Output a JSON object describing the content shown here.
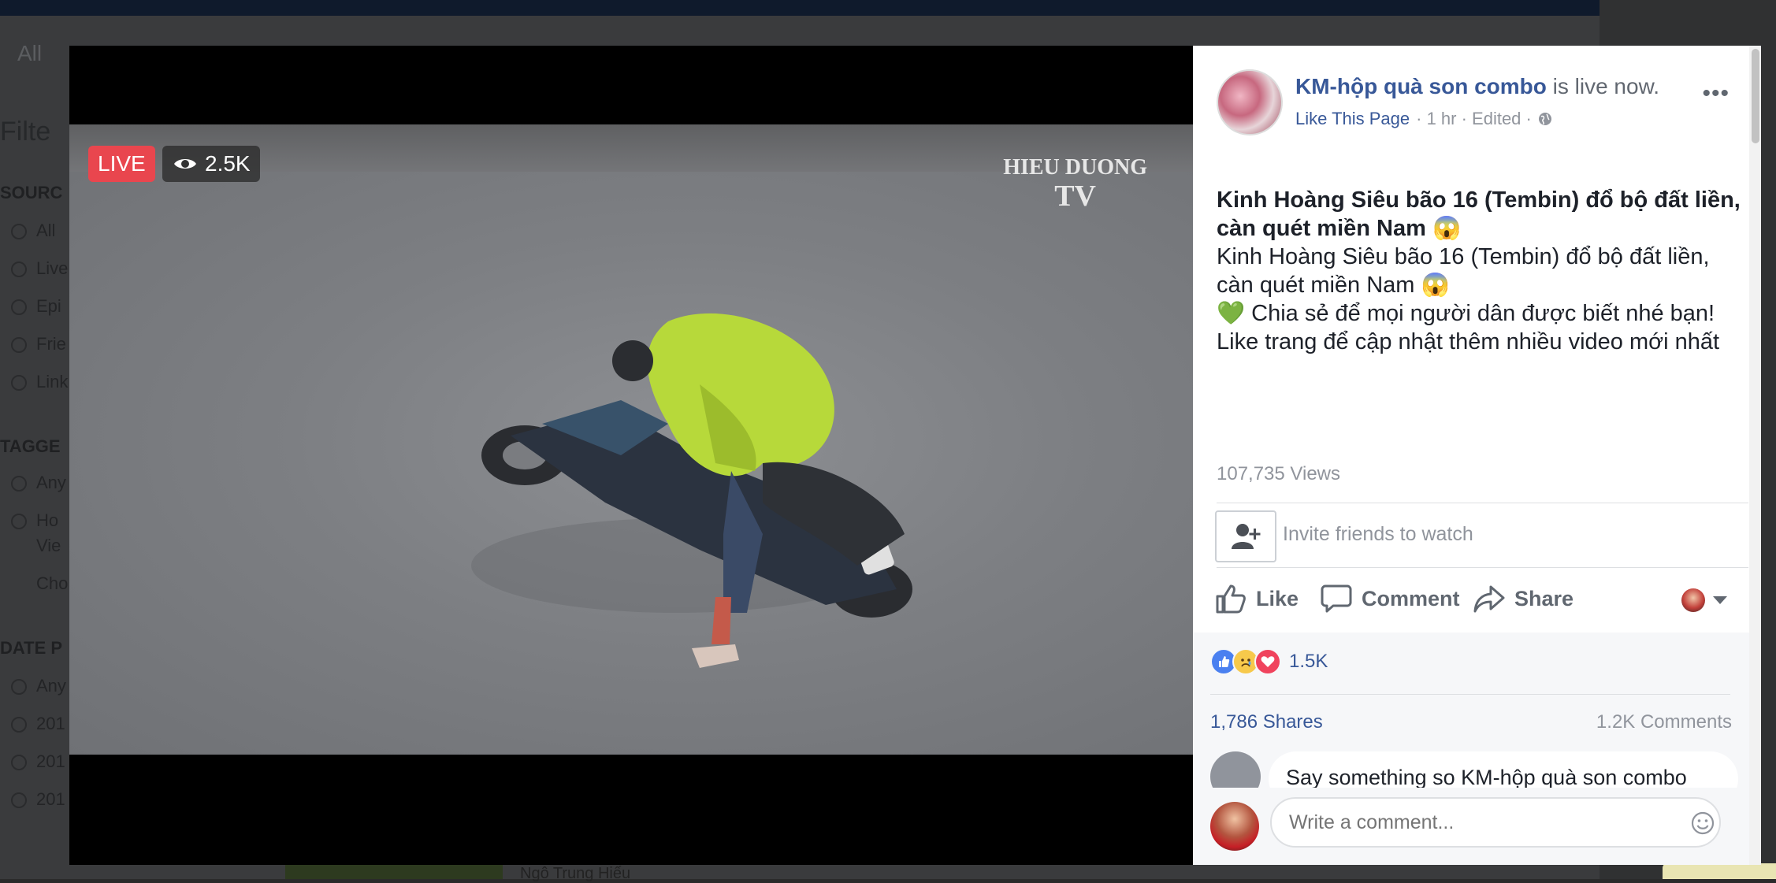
{
  "background": {
    "tab_label": "All",
    "filter_title": "Filte",
    "sections": [
      "SOURC",
      "TAGGE",
      "DATE P"
    ],
    "options": [
      "All",
      "Live",
      "Epi",
      "Frie",
      "Link",
      "Any",
      "Ho",
      "Vie",
      "Cho",
      "Any",
      "201",
      "201",
      "201"
    ],
    "caption": "Ngô Trung Hiếu"
  },
  "video": {
    "live_label": "LIVE",
    "viewer_count": "2.5K",
    "watermark_line1": "HIEU DUONG",
    "watermark_line2": "TV"
  },
  "post": {
    "page_name": "KM-hộp quà son combo",
    "status": " is live now.",
    "like_page": "Like This Page",
    "meta": "· 1 hr · Edited ·",
    "title": "Kinh Hoàng Siêu bão 16 (Tembin) đổ bộ đất liền, càn quét miền Nam 😱",
    "body_line1": "Kinh Hoàng Siêu bão 16 (Tembin) đổ bộ đất liền, càn quét miền Nam 😱",
    "body_line2": "💚 Chia sẻ để mọi người dân được biết nhé bạn!",
    "body_line3": "Like trang để cập nhật thêm nhiều video mới nhất",
    "views": "107,735 Views",
    "invite_text": "Invite friends to watch",
    "actions": {
      "like": "Like",
      "comment": "Comment",
      "share": "Share"
    },
    "reaction_count": "1.5K",
    "shares": "1,786 Shares",
    "comments": "1.2K Comments",
    "say_something": "Say something so KM-hộp quà son combo",
    "comment_placeholder": "Write a comment..."
  },
  "icons": [
    "eye-icon",
    "globe-icon",
    "more-icon",
    "add-friend-icon",
    "thumbs-up-icon",
    "comment-icon",
    "share-icon",
    "caret-down-icon",
    "like-reaction-icon",
    "sad-reaction-icon",
    "love-reaction-icon",
    "emoji-icon"
  ],
  "colors": {
    "live_red": "#e9464e",
    "link_blue": "#385898",
    "muted_gray": "#90949c"
  }
}
